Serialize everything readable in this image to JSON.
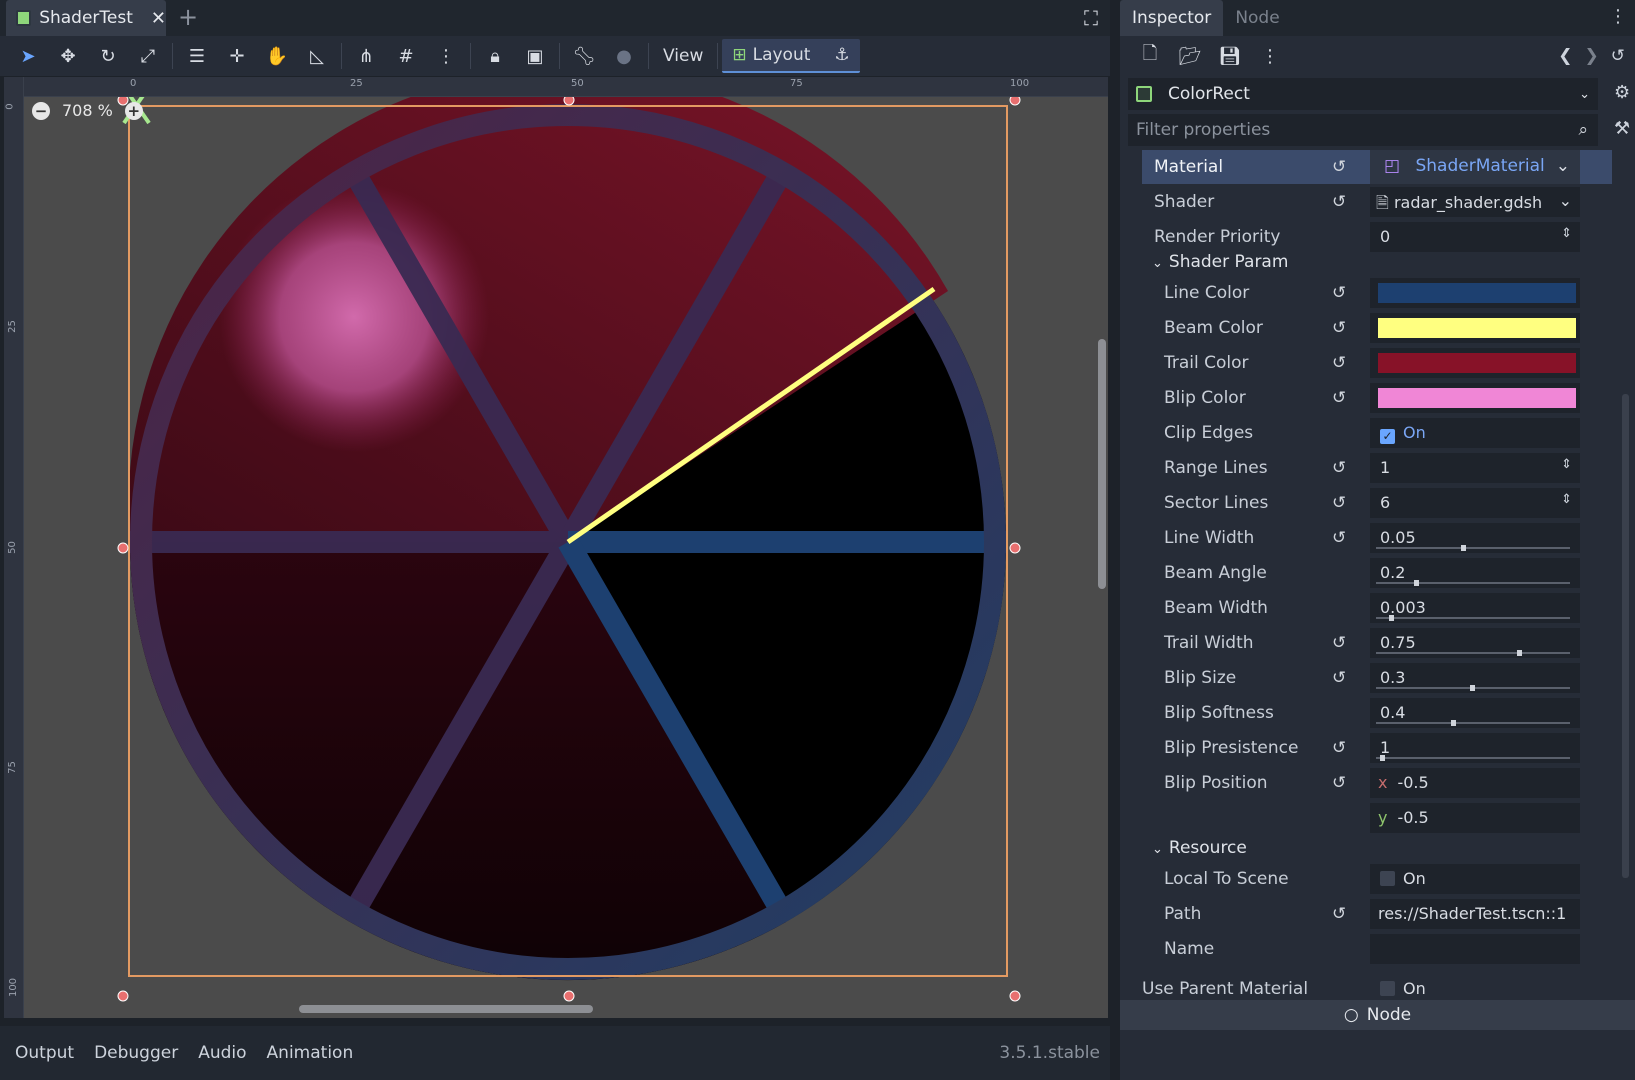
{
  "editor": {
    "tab_title": "ShaderTest",
    "tab_add": "+",
    "toolbar": {
      "view_label": "View",
      "layout_label": "Layout"
    },
    "zoom_label": "708 %",
    "ruler_top_ticks": [
      "0",
      "25",
      "50",
      "75",
      "100"
    ],
    "ruler_left_ticks": [
      "0",
      "25",
      "50",
      "75",
      "100"
    ],
    "radar_colors": {
      "line": "#1f3f66",
      "beam": "#ffff66",
      "trail": "#8a1224",
      "blip": "#f07bd0"
    }
  },
  "bottom_panel": {
    "tabs": [
      "Output",
      "Debugger",
      "Audio",
      "Animation"
    ],
    "version": "3.5.1.stable"
  },
  "inspector": {
    "tabs": {
      "inspector": "Inspector",
      "node": "Node"
    },
    "object_name": "ColorRect",
    "filter_placeholder": "Filter properties",
    "material": {
      "label": "Material",
      "value": "ShaderMaterial"
    },
    "shader": {
      "label": "Shader",
      "value": "radar_shader.gdsh"
    },
    "render_priority": {
      "label": "Render Priority",
      "value": "0"
    },
    "shader_param_section": "Shader Param",
    "line_color": {
      "label": "Line Color",
      "color": "#1d4070"
    },
    "beam_color": {
      "label": "Beam Color",
      "color": "#ffff80"
    },
    "trail_color": {
      "label": "Trail Color",
      "color": "#871228"
    },
    "blip_color": {
      "label": "Blip Color",
      "color": "#f086d6"
    },
    "clip_edges": {
      "label": "Clip Edges",
      "value": "On"
    },
    "range_lines": {
      "label": "Range Lines",
      "value": "1"
    },
    "sector_lines": {
      "label": "Sector Lines",
      "value": "6"
    },
    "line_width": {
      "label": "Line Width",
      "value": "0.05",
      "fraction": 0.45
    },
    "beam_angle": {
      "label": "Beam Angle",
      "value": "0.2",
      "fraction": 0.2
    },
    "beam_width": {
      "label": "Beam Width",
      "value": "0.003",
      "fraction": 0.07
    },
    "trail_width": {
      "label": "Trail Width",
      "value": "0.75",
      "fraction": 0.75
    },
    "blip_size": {
      "label": "Blip Size",
      "value": "0.3",
      "fraction": 0.5
    },
    "blip_softness": {
      "label": "Blip Softness",
      "value": "0.4",
      "fraction": 0.4
    },
    "blip_presistence": {
      "label": "Blip Presistence",
      "value": "1",
      "fraction": 0.02
    },
    "blip_position": {
      "label": "Blip Position",
      "x_axis": "x",
      "x": "-0.5",
      "y_axis": "y",
      "y": "-0.5"
    },
    "resource_section": "Resource",
    "local_to_scene": {
      "label": "Local To Scene",
      "value": "On"
    },
    "path": {
      "label": "Path",
      "value": "res://ShaderTest.tscn::1"
    },
    "name": {
      "label": "Name",
      "value": ""
    },
    "use_parent_material": {
      "label": "Use Parent Material",
      "value": "On"
    },
    "node_button": "Node"
  }
}
